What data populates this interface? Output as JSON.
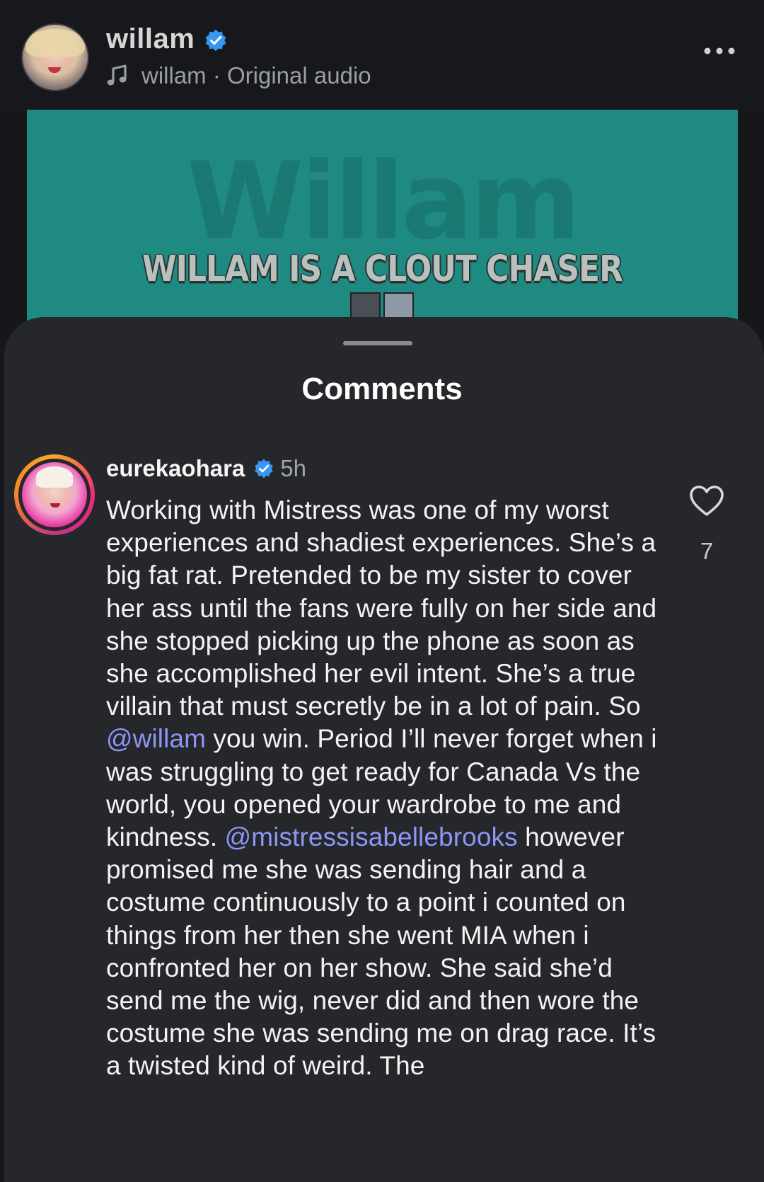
{
  "header": {
    "username": "willam",
    "audio_author": "willam",
    "audio_separator": " · ",
    "audio_label": "Original audio",
    "icons": [
      "verified-badge-icon",
      "music-note-icon",
      "more-options-icon"
    ]
  },
  "video": {
    "overlay_title": "Willam",
    "overlay_caption": "WILLAM IS A CLOUT CHASER",
    "background_color": "#1e8a82"
  },
  "comments_sheet": {
    "title": "Comments",
    "comment": {
      "username": "eurekaohara",
      "time_ago": "5h",
      "like_count": "7",
      "segments": [
        {
          "type": "text",
          "value": "Working with Mistress was one of my worst experiences and shadiest experiences. She’s a big fat rat. Pretended to be my sister to cover her ass until the fans were fully on her side and she stopped picking up the phone as soon as she accomplished her evil intent. She’s a true villain that must secretly be in a lot of pain. So "
        },
        {
          "type": "mention",
          "value": "@willam"
        },
        {
          "type": "text",
          "value": " you win. Period I’ll never forget when i was struggling to get ready for Canada Vs the world, you opened your wardrobe to me and kindness. "
        },
        {
          "type": "mention",
          "value": "@mistressisabellebrooks"
        },
        {
          "type": "text",
          "value": " however promised me she was sending hair and a costume continuously to a point i counted on things from her then she went MIA when i confronted her on her show. She said she’d send me the wig, never did and then wore the costume she was sending me on drag race. It’s a twisted kind of weird. The"
        }
      ]
    }
  },
  "colors": {
    "accent_mention": "#8f95f5",
    "verified_blue": "#3897f0",
    "sheet_background": "#25272b"
  }
}
